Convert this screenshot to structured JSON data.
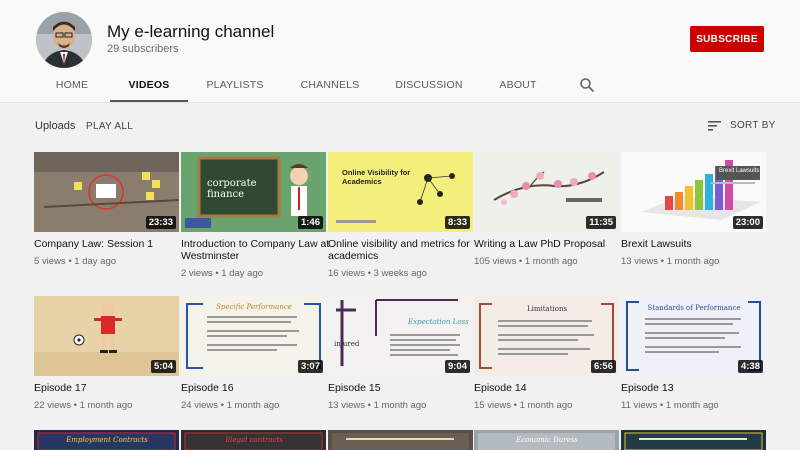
{
  "channel": {
    "title": "My e-learning channel",
    "subscribers": "29 subscribers",
    "subscribe_label": "SUBSCRIBE"
  },
  "tabs": [
    {
      "label": "HOME",
      "active": false
    },
    {
      "label": "VIDEOS",
      "active": true
    },
    {
      "label": "PLAYLISTS",
      "active": false
    },
    {
      "label": "CHANNELS",
      "active": false
    },
    {
      "label": "DISCUSSION",
      "active": false
    },
    {
      "label": "ABOUT",
      "active": false
    }
  ],
  "section": {
    "title": "Uploads",
    "play_all": "PLAY ALL",
    "sort_by": "SORT BY"
  },
  "videos": [
    {
      "title": "Company Law: Session 1",
      "views": "5 views",
      "age": "1 day ago",
      "duration": "23:33",
      "thumb_text": ""
    },
    {
      "title": "Introduction to Company Law at Westminster",
      "views": "2 views",
      "age": "1 day ago",
      "duration": "1:46",
      "thumb_text": "corporate finance"
    },
    {
      "title": "Online visibility and metrics for academics",
      "views": "16 views",
      "age": "3 weeks ago",
      "duration": "8:33",
      "thumb_text": "Online Visibility for Academics"
    },
    {
      "title": "Writing a Law PhD Proposal",
      "views": "105 views",
      "age": "1 month ago",
      "duration": "11:35",
      "thumb_text": ""
    },
    {
      "title": "Brexit Lawsuits",
      "views": "13 views",
      "age": "1 month ago",
      "duration": "23:00",
      "thumb_text": "Brexit Lawsuits"
    },
    {
      "title": "Episode 17",
      "views": "22 views",
      "age": "1 month ago",
      "duration": "5:04",
      "thumb_text": ""
    },
    {
      "title": "Episode 16",
      "views": "24 views",
      "age": "1 month ago",
      "duration": "3:07",
      "thumb_text": "Specific Performance"
    },
    {
      "title": "Episode 15",
      "views": "13 views",
      "age": "1 month ago",
      "duration": "9:04",
      "thumb_text": "Expectation Loss"
    },
    {
      "title": "Episode 14",
      "views": "15 views",
      "age": "1 month ago",
      "duration": "6:56",
      "thumb_text": "Limitations"
    },
    {
      "title": "Episode 13",
      "views": "11 views",
      "age": "1 month ago",
      "duration": "4:38",
      "thumb_text": "Standards of Performance"
    },
    {
      "title": "",
      "views": "",
      "age": "",
      "duration": "",
      "thumb_text": "Employment Contracts"
    },
    {
      "title": "",
      "views": "",
      "age": "",
      "duration": "",
      "thumb_text": "Illegal contracts"
    },
    {
      "title": "",
      "views": "",
      "age": "",
      "duration": "",
      "thumb_text": ""
    },
    {
      "title": "",
      "views": "",
      "age": "",
      "duration": "",
      "thumb_text": "Economic Duress"
    },
    {
      "title": "",
      "views": "",
      "age": "",
      "duration": "",
      "thumb_text": ""
    }
  ],
  "colors": {
    "subscribe_red": "#cc0000",
    "background": "#f1f1f1",
    "header_bg": "#f9f9f9"
  },
  "icons": {
    "search": "search-icon",
    "sort": "sort-icon"
  }
}
